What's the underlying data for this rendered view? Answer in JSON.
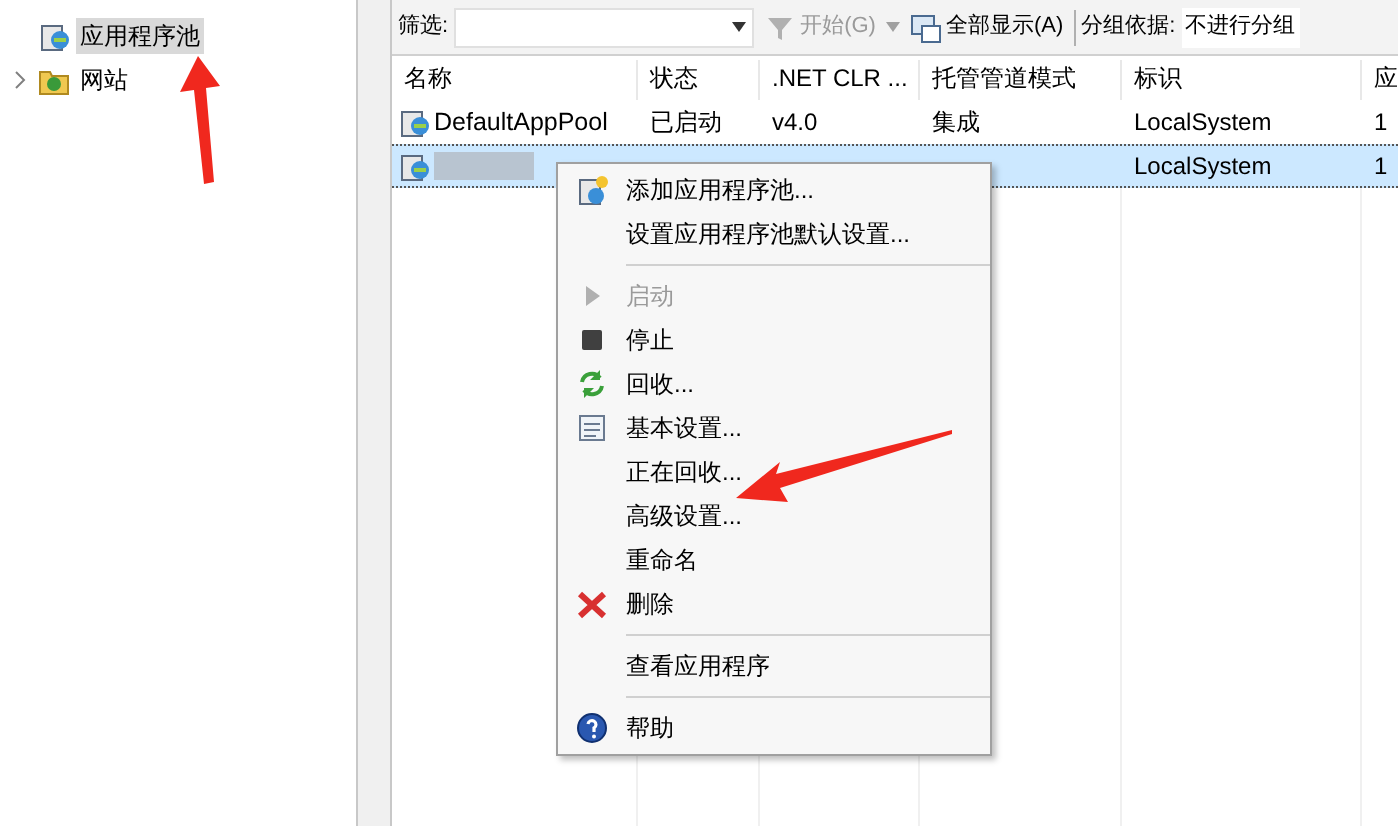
{
  "tree": {
    "items": [
      {
        "label": "应用程序池",
        "selected": true
      },
      {
        "label": "网站",
        "selected": false
      }
    ]
  },
  "toolbar": {
    "filter_label": "筛选:",
    "start_button": "开始(G)",
    "show_all_button": "全部显示(A)",
    "group_label": "分组依据:",
    "group_value": "不进行分组"
  },
  "table": {
    "columns": [
      "名称",
      "状态",
      ".NET CLR ...",
      "托管管道模式",
      "标识",
      "应"
    ],
    "rows": [
      {
        "cells": [
          "DefaultAppPool",
          "已启动",
          "v4.0",
          "集成",
          "LocalSystem",
          "1"
        ],
        "selected": false,
        "name_hidden": false
      },
      {
        "cells": [
          "",
          "",
          "",
          "",
          "LocalSystem",
          "1"
        ],
        "selected": true,
        "name_hidden": true
      }
    ]
  },
  "context_menu": {
    "items": [
      {
        "kind": "item",
        "label": "添加应用程序池...",
        "disabled": false
      },
      {
        "kind": "item",
        "label": "设置应用程序池默认设置...",
        "disabled": false
      },
      {
        "kind": "separator"
      },
      {
        "kind": "item",
        "label": "启动",
        "disabled": true
      },
      {
        "kind": "item",
        "label": "停止",
        "disabled": false
      },
      {
        "kind": "item",
        "label": "回收...",
        "disabled": false
      },
      {
        "kind": "item",
        "label": "基本设置...",
        "disabled": false
      },
      {
        "kind": "item",
        "label": "正在回收...",
        "disabled": false
      },
      {
        "kind": "item",
        "label": "高级设置...",
        "disabled": false
      },
      {
        "kind": "item",
        "label": "重命名",
        "disabled": false
      },
      {
        "kind": "item",
        "label": "删除",
        "disabled": false
      },
      {
        "kind": "separator"
      },
      {
        "kind": "item",
        "label": "查看应用程序",
        "disabled": false
      },
      {
        "kind": "separator"
      },
      {
        "kind": "item",
        "label": "帮助",
        "disabled": false
      }
    ]
  }
}
